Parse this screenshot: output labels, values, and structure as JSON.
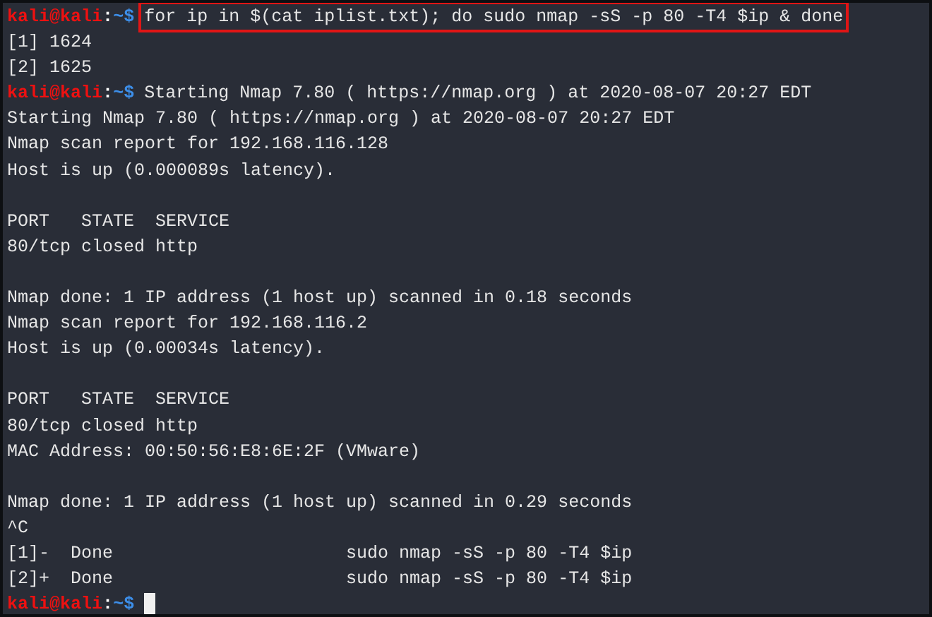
{
  "lines": [
    {
      "kind": "highlighted_prompt",
      "user": "kali",
      "at": "@",
      "host": "kali",
      "sep": ":",
      "path": "~",
      "symbol": "$",
      "command": "for ip in $(cat iplist.txt); do sudo nmap -sS -p 80 -T4 $ip & done"
    },
    {
      "kind": "output",
      "text": "[1] 1624"
    },
    {
      "kind": "output",
      "text": "[2] 1625"
    },
    {
      "kind": "prompt",
      "user": "kali",
      "at": "@",
      "host": "kali",
      "sep": ":",
      "path": "~",
      "symbol": "$",
      "command": "Starting Nmap 7.80 ( https://nmap.org ) at 2020-08-07 20:27 EDT"
    },
    {
      "kind": "output",
      "text": "Starting Nmap 7.80 ( https://nmap.org ) at 2020-08-07 20:27 EDT"
    },
    {
      "kind": "output",
      "text": "Nmap scan report for 192.168.116.128"
    },
    {
      "kind": "output",
      "text": "Host is up (0.000089s latency)."
    },
    {
      "kind": "blank"
    },
    {
      "kind": "output",
      "text": "PORT   STATE  SERVICE"
    },
    {
      "kind": "output",
      "text": "80/tcp closed http"
    },
    {
      "kind": "blank"
    },
    {
      "kind": "output",
      "text": "Nmap done: 1 IP address (1 host up) scanned in 0.18 seconds"
    },
    {
      "kind": "output",
      "text": "Nmap scan report for 192.168.116.2"
    },
    {
      "kind": "output",
      "text": "Host is up (0.00034s latency)."
    },
    {
      "kind": "blank"
    },
    {
      "kind": "output",
      "text": "PORT   STATE  SERVICE"
    },
    {
      "kind": "output",
      "text": "80/tcp closed http"
    },
    {
      "kind": "output",
      "text": "MAC Address: 00:50:56:E8:6E:2F (VMware)"
    },
    {
      "kind": "blank"
    },
    {
      "kind": "output",
      "text": "Nmap done: 1 IP address (1 host up) scanned in 0.29 seconds"
    },
    {
      "kind": "output",
      "text": "^C"
    },
    {
      "kind": "output",
      "text": "[1]-  Done                      sudo nmap -sS -p 80 -T4 $ip"
    },
    {
      "kind": "output",
      "text": "[2]+  Done                      sudo nmap -sS -p 80 -T4 $ip"
    },
    {
      "kind": "cursor_prompt",
      "user": "kali",
      "at": "@",
      "host": "kali",
      "sep": ":",
      "path": "~",
      "symbol": "$"
    }
  ]
}
